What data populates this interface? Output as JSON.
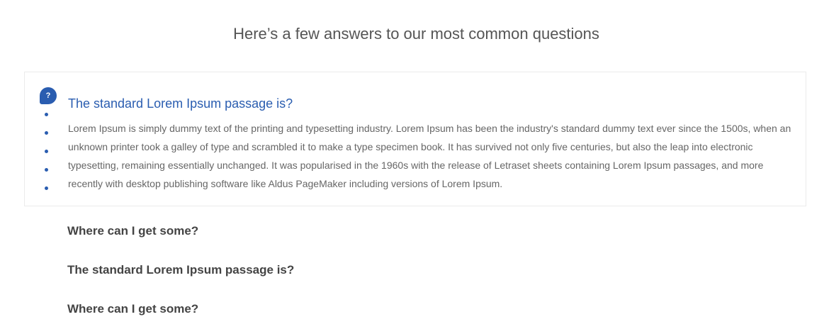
{
  "heading": "Here’s a few answers to our most common questions",
  "faq": {
    "open_item": {
      "badge": "?",
      "question": "The standard Lorem Ipsum passage is?",
      "answer": "Lorem Ipsum is simply dummy text of the printing and typesetting industry. Lorem Ipsum has been the industry's standard dummy text ever since the 1500s, when an unknown printer took a galley of type and scrambled it to make a type specimen book. It has survived not only five centuries, but also the leap into electronic typesetting, remaining essentially unchanged. It was popularised in the 1960s with the release of Letraset sheets containing Lorem Ipsum passages, and more recently with desktop publishing software like Aldus PageMaker including versions of Lorem Ipsum."
    },
    "closed_items": [
      {
        "question": "Where can I get some?"
      },
      {
        "question": "The standard Lorem Ipsum passage is?"
      },
      {
        "question": "Where can I get some?"
      }
    ]
  },
  "colors": {
    "accent": "#2a5db0",
    "heading_text": "#555555",
    "body_text": "#666666",
    "closed_question_text": "#444444",
    "border": "#ebebeb"
  },
  "icons": {
    "question_badge": "question-bubble-icon"
  }
}
